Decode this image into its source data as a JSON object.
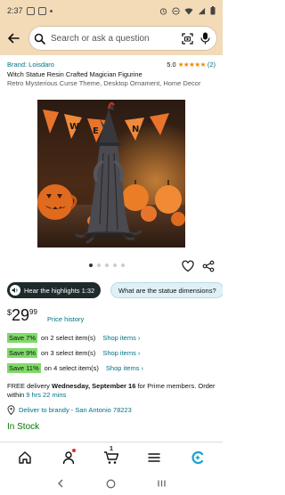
{
  "status_bar": {
    "time": "2:37"
  },
  "search": {
    "placeholder": "Search or ask a question"
  },
  "product": {
    "brand": "Brand: Loisdaro",
    "rating_value": "5.0",
    "rating_stars": "★★★★★",
    "rating_count": "(2)",
    "title": "Witch Statue Resin Crafted Magician Figurine",
    "subtitle": "Retro Mysterious Curse Theme, Desktop Ornament, Home Decor",
    "image_count": 5,
    "image_active_index": 0
  },
  "highlights": {
    "button_label": "Hear the highlights 1:32",
    "question_chip": "What are the statue dimensions?"
  },
  "price": {
    "currency": "$",
    "whole": "29",
    "fraction": "99",
    "history_link": "Price history"
  },
  "savings": [
    {
      "badge": "Save 7%",
      "text": "on 2 select item(s)",
      "link": "Shop items ›"
    },
    {
      "badge": "Save 9%",
      "text": "on 3 select item(s)",
      "link": "Shop items ›"
    },
    {
      "badge": "Save 11%",
      "text": "on 4 select item(s)",
      "link": "Shop items ›"
    }
  ],
  "delivery": {
    "prefix": "FREE delivery ",
    "date": "Wednesday, September 16",
    "middle": " for Prime members. Order within ",
    "countdown": "9 hrs 22 mins"
  },
  "deliver_to": "Deliver to brandy - San Antonio 78223",
  "stock": "In Stock",
  "bottom_nav": {
    "cart_count": "1"
  },
  "colors": {
    "header_bg": "#f3dbb8",
    "link": "#007185",
    "save_badge": "#7fda69",
    "in_stock": "#007600",
    "star": "#f08804"
  }
}
